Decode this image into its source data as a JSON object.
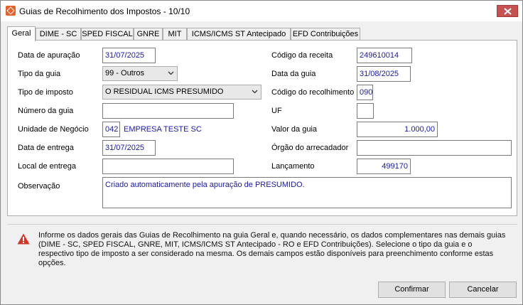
{
  "window": {
    "title": "Guias de Recolhimento dos Impostos - 10/10"
  },
  "tabs": [
    "Geral",
    "DIME - SC",
    "SPED FISCAL",
    "GNRE",
    "MIT",
    "ICMS/ICMS ST Antecipado",
    "EFD Contribuições"
  ],
  "left": {
    "data_apuracao_label": "Data de apuração",
    "data_apuracao_value": "31/07/2025",
    "tipo_guia_label": "Tipo da guia",
    "tipo_guia_value": "99 - Outros",
    "tipo_imposto_label": "Tipo de imposto",
    "tipo_imposto_value": "O RESIDUAL ICMS PRESUMIDO",
    "numero_guia_label": "Número da guia",
    "numero_guia_value": "",
    "unidade_label": "Unidade de Negócio",
    "unidade_code": "042",
    "unidade_name": "EMPRESA TESTE SC",
    "data_entrega_label": "Data de entrega",
    "data_entrega_value": "31/07/2025",
    "local_entrega_label": "Local de entrega",
    "local_entrega_value": ""
  },
  "right": {
    "codigo_receita_label": "Código da receita",
    "codigo_receita_value": "249610014",
    "data_guia_label": "Data da guia",
    "data_guia_value": "31/08/2025",
    "codigo_recolhimento_label": "Código do recolhimento",
    "codigo_recolhimento_value": "090",
    "uf_label": "UF",
    "uf_value": "",
    "valor_guia_label": "Valor da guia",
    "valor_guia_value": "1.000,00",
    "orgao_label": "Órgão do arrecadador",
    "orgao_value": "",
    "lancamento_label": "Lançamento",
    "lancamento_value": "499170"
  },
  "observacao": {
    "label": "Observação",
    "value": "Criado automaticamente pela apuração de PRESUMIDO."
  },
  "info": {
    "icon": "warning-icon",
    "text": "Informe os dados gerais das Guias de Recolhimento na guia Geral e, quando necessário, os dados complementares nas demais guias (DIME - SC, SPED FISCAL, GNRE, MIT, ICMS/ICMS ST Antecipado - RO e EFD Contribuições). Selecione o tipo da guia e o respectivo tipo de imposto a ser considerado na mesma. Os demais campos estão disponíveis para preenchimento conforme estas opções."
  },
  "buttons": {
    "confirm": "Confirmar",
    "cancel": "Cancelar"
  },
  "colors": {
    "value_text": "#1a1aa6",
    "close_button": "#c75050",
    "warning": "#d9342b"
  }
}
